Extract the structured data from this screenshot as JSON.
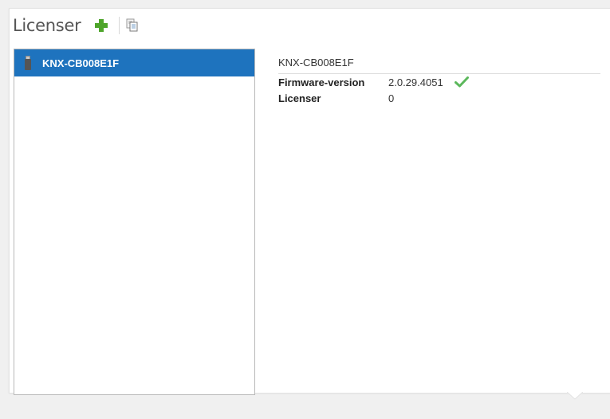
{
  "header": {
    "title": "Licenser",
    "add_icon": "plus-icon",
    "copy_icon": "copy-icon"
  },
  "device_list": {
    "items": [
      {
        "label": "KNX-CB008E1F",
        "icon": "usb-stick-icon",
        "selected": true
      }
    ]
  },
  "details": {
    "device_name": "KNX-CB008E1F",
    "properties": [
      {
        "label": "Firmware-version",
        "value": "2.0.29.4051",
        "status_icon": "checkmark-icon"
      },
      {
        "label": "Licenser",
        "value": "0"
      }
    ]
  },
  "colors": {
    "selection": "#1e73be",
    "add_green": "#4ea52b",
    "check_green": "#5cb85c"
  }
}
